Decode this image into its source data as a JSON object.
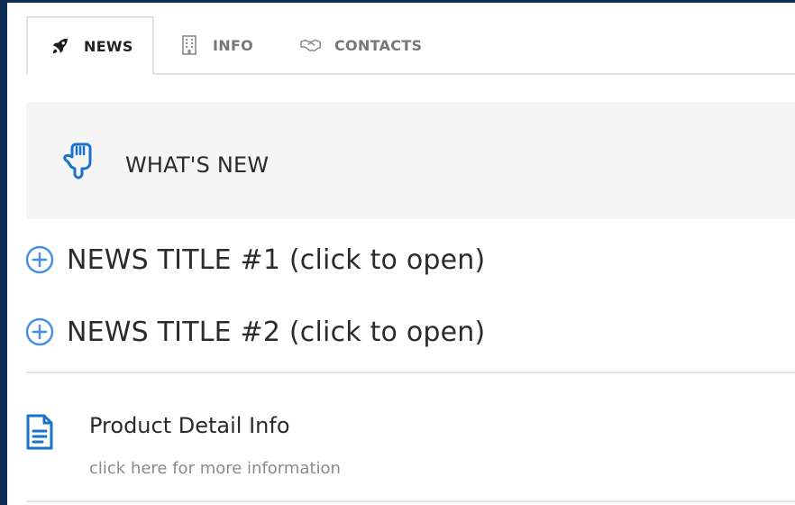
{
  "tabs": [
    {
      "label": "NEWS",
      "icon": "rocket-icon",
      "active": true
    },
    {
      "label": "INFO",
      "icon": "building-icon",
      "active": false
    },
    {
      "label": "CONTACTS",
      "icon": "handshake-icon",
      "active": false
    }
  ],
  "whats_new": {
    "icon": "pointing-hand-icon",
    "title": "WHAT'S NEW"
  },
  "news_items": [
    {
      "icon": "plus-circle-icon",
      "title": "NEWS TITLE #1 (click to open)"
    },
    {
      "icon": "plus-circle-icon",
      "title": "NEWS TITLE #2 (click to open)"
    }
  ],
  "product_info": {
    "icon": "document-icon",
    "title": "Product Detail Info",
    "subtitle": "click here for more information"
  },
  "colors": {
    "frame_background": "#0f2d55",
    "accent_blue": "#1a73c9",
    "plus_icon_blue": "#4a90e2",
    "panel_background": "#f5f5f5"
  }
}
